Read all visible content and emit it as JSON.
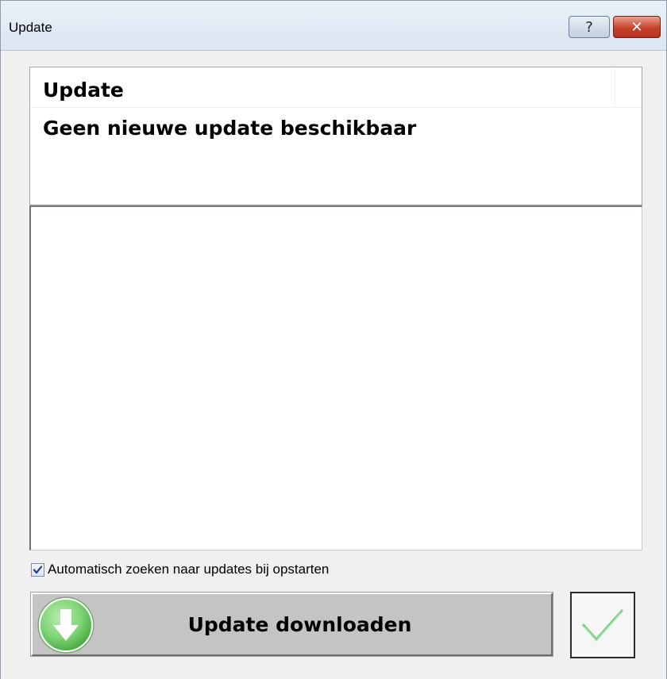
{
  "window": {
    "title": "Update",
    "help_glyph": "?",
    "close_glyph": "✕"
  },
  "header": {
    "title": "Update",
    "status": "Geen nieuwe update beschikbaar"
  },
  "notes": {
    "text": ""
  },
  "options": {
    "auto_check_label": "Automatisch zoeken naar updates bij opstarten",
    "auto_check_checked": true
  },
  "actions": {
    "download_label": "Update downloaden",
    "download_icon": "download-arrow-icon",
    "ok_icon": "checkmark-icon"
  },
  "colors": {
    "accent_green": "#5fbf57",
    "close_red": "#c7412b",
    "button_gray": "#c4c4c4"
  }
}
